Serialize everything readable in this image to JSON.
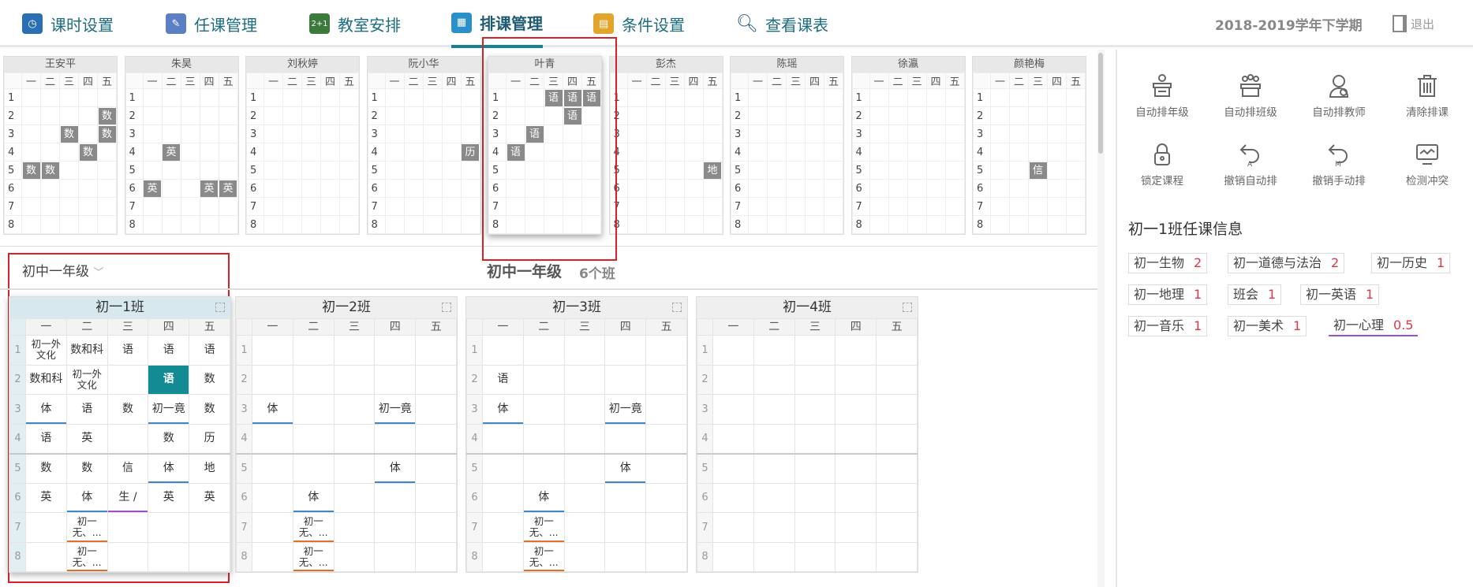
{
  "nav": {
    "items": [
      {
        "label": "课时设置",
        "icon": "clock-icon"
      },
      {
        "label": "任课管理",
        "icon": "pencil-icon"
      },
      {
        "label": "教室安排",
        "icon": "blackboard-icon"
      },
      {
        "label": "排课管理",
        "icon": "schedule-grid-icon"
      },
      {
        "label": "条件设置",
        "icon": "document-icon"
      },
      {
        "label": "查看课表",
        "icon": "search-icon"
      }
    ],
    "active": "排课管理",
    "term": "2018-2019学年下学期",
    "logout": "退出"
  },
  "weekdays": [
    "一",
    "二",
    "三",
    "四",
    "五"
  ],
  "periods": [
    "1",
    "2",
    "3",
    "4",
    "5",
    "6",
    "7",
    "8"
  ],
  "teachers": [
    {
      "name": "王安平",
      "cells": [
        [
          "",
          "",
          "",
          "",
          ""
        ],
        [
          "",
          "",
          "",
          "",
          "数"
        ],
        [
          "",
          "",
          "数",
          "",
          "数"
        ],
        [
          "",
          "",
          "",
          "数",
          ""
        ],
        [
          "数",
          "数",
          "",
          "",
          ""
        ],
        [
          "",
          "",
          "",
          "",
          ""
        ],
        [
          "",
          "",
          "",
          "",
          ""
        ],
        [
          "",
          "",
          "",
          "",
          ""
        ]
      ]
    },
    {
      "name": "朱昊",
      "cells": [
        [
          "",
          "",
          "",
          "",
          ""
        ],
        [
          "",
          "",
          "",
          "",
          ""
        ],
        [
          "",
          "",
          "",
          "",
          ""
        ],
        [
          "",
          "英",
          "",
          "",
          ""
        ],
        [
          "",
          "",
          "",
          "",
          ""
        ],
        [
          "英",
          "",
          "",
          "英",
          "英"
        ],
        [
          "",
          "",
          "",
          "",
          ""
        ],
        [
          "",
          "",
          "",
          "",
          ""
        ]
      ]
    },
    {
      "name": "刘秋婷",
      "cells": [
        [
          "",
          "",
          "",
          "",
          ""
        ],
        [
          "",
          "",
          "",
          "",
          ""
        ],
        [
          "",
          "",
          "",
          "",
          ""
        ],
        [
          "",
          "",
          "",
          "",
          ""
        ],
        [
          "",
          "",
          "",
          "",
          ""
        ],
        [
          "",
          "",
          "",
          "",
          ""
        ],
        [
          "",
          "",
          "",
          "",
          ""
        ],
        [
          "",
          "",
          "",
          "",
          ""
        ]
      ]
    },
    {
      "name": "阮小华",
      "cells": [
        [
          "",
          "",
          "",
          "",
          ""
        ],
        [
          "",
          "",
          "",
          "",
          ""
        ],
        [
          "",
          "",
          "",
          "",
          ""
        ],
        [
          "",
          "",
          "",
          "",
          "历"
        ],
        [
          "",
          "",
          "",
          "",
          ""
        ],
        [
          "",
          "",
          "",
          "",
          ""
        ],
        [
          "",
          "",
          "",
          "",
          ""
        ],
        [
          "",
          "",
          "",
          "",
          ""
        ]
      ]
    },
    {
      "name": "叶青",
      "cells": [
        [
          "",
          "",
          "语",
          "语",
          "语"
        ],
        [
          "",
          "",
          "",
          "语",
          ""
        ],
        [
          "",
          "语",
          "",
          "",
          ""
        ],
        [
          "语",
          "",
          "",
          "",
          ""
        ],
        [
          "",
          "",
          "",
          "",
          ""
        ],
        [
          "",
          "",
          "",
          "",
          ""
        ],
        [
          "",
          "",
          "",
          "",
          ""
        ],
        [
          "",
          "",
          "",
          "",
          ""
        ]
      ]
    },
    {
      "name": "彭杰",
      "cells": [
        [
          "",
          "",
          "",
          "",
          ""
        ],
        [
          "",
          "",
          "",
          "",
          ""
        ],
        [
          "",
          "",
          "",
          "",
          ""
        ],
        [
          "",
          "",
          "",
          "",
          ""
        ],
        [
          "",
          "",
          "",
          "",
          "地"
        ],
        [
          "",
          "",
          "",
          "",
          ""
        ],
        [
          "",
          "",
          "",
          "",
          ""
        ],
        [
          "",
          "",
          "",
          "",
          ""
        ]
      ]
    },
    {
      "name": "陈瑶",
      "cells": [
        [
          "",
          "",
          "",
          "",
          ""
        ],
        [
          "",
          "",
          "",
          "",
          ""
        ],
        [
          "",
          "",
          "",
          "",
          ""
        ],
        [
          "",
          "",
          "",
          "",
          ""
        ],
        [
          "",
          "",
          "",
          "",
          ""
        ],
        [
          "",
          "",
          "",
          "",
          ""
        ],
        [
          "",
          "",
          "",
          "",
          ""
        ],
        [
          "",
          "",
          "",
          "",
          ""
        ]
      ]
    },
    {
      "name": "徐瀛",
      "cells": [
        [
          "",
          "",
          "",
          "",
          ""
        ],
        [
          "",
          "",
          "",
          "",
          ""
        ],
        [
          "",
          "",
          "",
          "",
          ""
        ],
        [
          "",
          "",
          "",
          "",
          ""
        ],
        [
          "",
          "",
          "",
          "",
          ""
        ],
        [
          "",
          "",
          "",
          "",
          ""
        ],
        [
          "",
          "",
          "",
          "",
          ""
        ],
        [
          "",
          "",
          "",
          "",
          ""
        ]
      ]
    },
    {
      "name": "颜艳梅",
      "cells": [
        [
          "",
          "",
          "",
          "",
          ""
        ],
        [
          "",
          "",
          "",
          "",
          ""
        ],
        [
          "",
          "",
          "",
          "",
          ""
        ],
        [
          "",
          "",
          "",
          "",
          ""
        ],
        [
          "",
          "",
          "信",
          "",
          ""
        ],
        [
          "",
          "",
          "",
          "",
          ""
        ],
        [
          "",
          "",
          "",
          "",
          ""
        ],
        [
          "",
          "",
          "",
          "",
          ""
        ]
      ]
    }
  ],
  "grade": {
    "selector": "初中一年级",
    "title": "初中一年级",
    "count": "6个班"
  },
  "classes": [
    {
      "name": "初一1班",
      "cells": [
        [
          {
            "t": "初一外\n文化"
          },
          {
            "t": "数和科"
          },
          {
            "t": "语"
          },
          {
            "t": "语"
          },
          {
            "t": "语"
          }
        ],
        [
          {
            "t": "数和科"
          },
          {
            "t": "初一外\n文化"
          },
          {
            "t": ""
          },
          {
            "t": "语",
            "s": "hl"
          },
          {
            "t": "数"
          }
        ],
        [
          {
            "t": "体",
            "s": "ub"
          },
          {
            "t": "语"
          },
          {
            "t": "数"
          },
          {
            "t": "初一竟",
            "s": "ub"
          },
          {
            "t": "数"
          }
        ],
        [
          {
            "t": "语"
          },
          {
            "t": "英"
          },
          {
            "t": ""
          },
          {
            "t": "数"
          },
          {
            "t": "历"
          }
        ],
        [
          {
            "t": "数"
          },
          {
            "t": "数"
          },
          {
            "t": "信"
          },
          {
            "t": "体",
            "s": "ub"
          },
          {
            "t": "地"
          }
        ],
        [
          {
            "t": "英"
          },
          {
            "t": "体",
            "s": "ub"
          },
          {
            "t": "生 /",
            "s": "up"
          },
          {
            "t": "英"
          },
          {
            "t": "英"
          }
        ],
        [
          {
            "t": ""
          },
          {
            "t": "初一\n无、...",
            "s": "uo"
          },
          {
            "t": ""
          },
          {
            "t": ""
          },
          {
            "t": ""
          }
        ],
        [
          {
            "t": ""
          },
          {
            "t": "初一\n无、...",
            "s": "uo"
          },
          {
            "t": ""
          },
          {
            "t": ""
          },
          {
            "t": ""
          }
        ]
      ]
    },
    {
      "name": "初一2班",
      "cells": [
        [
          {
            "t": ""
          },
          {
            "t": ""
          },
          {
            "t": ""
          },
          {
            "t": ""
          },
          {
            "t": ""
          }
        ],
        [
          {
            "t": ""
          },
          {
            "t": ""
          },
          {
            "t": ""
          },
          {
            "t": ""
          },
          {
            "t": ""
          }
        ],
        [
          {
            "t": "体",
            "s": "ub"
          },
          {
            "t": ""
          },
          {
            "t": ""
          },
          {
            "t": "初一竟",
            "s": "ub"
          },
          {
            "t": ""
          }
        ],
        [
          {
            "t": ""
          },
          {
            "t": ""
          },
          {
            "t": ""
          },
          {
            "t": ""
          },
          {
            "t": ""
          }
        ],
        [
          {
            "t": ""
          },
          {
            "t": ""
          },
          {
            "t": ""
          },
          {
            "t": "体",
            "s": "ub"
          },
          {
            "t": ""
          }
        ],
        [
          {
            "t": ""
          },
          {
            "t": "体",
            "s": "ub"
          },
          {
            "t": ""
          },
          {
            "t": ""
          },
          {
            "t": ""
          }
        ],
        [
          {
            "t": ""
          },
          {
            "t": "初一\n无、...",
            "s": "uo"
          },
          {
            "t": ""
          },
          {
            "t": ""
          },
          {
            "t": ""
          }
        ],
        [
          {
            "t": ""
          },
          {
            "t": "初一\n无、...",
            "s": "uo"
          },
          {
            "t": ""
          },
          {
            "t": ""
          },
          {
            "t": ""
          }
        ]
      ]
    },
    {
      "name": "初一3班",
      "cells": [
        [
          {
            "t": ""
          },
          {
            "t": ""
          },
          {
            "t": ""
          },
          {
            "t": ""
          },
          {
            "t": ""
          }
        ],
        [
          {
            "t": "语"
          },
          {
            "t": ""
          },
          {
            "t": ""
          },
          {
            "t": ""
          },
          {
            "t": ""
          }
        ],
        [
          {
            "t": "体",
            "s": "ub"
          },
          {
            "t": ""
          },
          {
            "t": ""
          },
          {
            "t": "初一竟",
            "s": "ub"
          },
          {
            "t": ""
          }
        ],
        [
          {
            "t": ""
          },
          {
            "t": ""
          },
          {
            "t": ""
          },
          {
            "t": ""
          },
          {
            "t": ""
          }
        ],
        [
          {
            "t": ""
          },
          {
            "t": ""
          },
          {
            "t": ""
          },
          {
            "t": "体",
            "s": "ub"
          },
          {
            "t": ""
          }
        ],
        [
          {
            "t": ""
          },
          {
            "t": "体",
            "s": "ub"
          },
          {
            "t": ""
          },
          {
            "t": ""
          },
          {
            "t": ""
          }
        ],
        [
          {
            "t": ""
          },
          {
            "t": "初一\n无、...",
            "s": "uo"
          },
          {
            "t": ""
          },
          {
            "t": ""
          },
          {
            "t": ""
          }
        ],
        [
          {
            "t": ""
          },
          {
            "t": "初一\n无、...",
            "s": "uo"
          },
          {
            "t": ""
          },
          {
            "t": ""
          },
          {
            "t": ""
          }
        ]
      ]
    },
    {
      "name": "初一4班",
      "cells": [
        [
          {
            "t": ""
          },
          {
            "t": ""
          },
          {
            "t": ""
          },
          {
            "t": ""
          },
          {
            "t": ""
          }
        ],
        [
          {
            "t": ""
          },
          {
            "t": ""
          },
          {
            "t": ""
          },
          {
            "t": ""
          },
          {
            "t": ""
          }
        ],
        [
          {
            "t": ""
          },
          {
            "t": ""
          },
          {
            "t": ""
          },
          {
            "t": ""
          },
          {
            "t": ""
          }
        ],
        [
          {
            "t": ""
          },
          {
            "t": ""
          },
          {
            "t": ""
          },
          {
            "t": ""
          },
          {
            "t": ""
          }
        ],
        [
          {
            "t": ""
          },
          {
            "t": ""
          },
          {
            "t": ""
          },
          {
            "t": ""
          },
          {
            "t": ""
          }
        ],
        [
          {
            "t": ""
          },
          {
            "t": ""
          },
          {
            "t": ""
          },
          {
            "t": ""
          },
          {
            "t": ""
          }
        ],
        [
          {
            "t": ""
          },
          {
            "t": ""
          },
          {
            "t": ""
          },
          {
            "t": ""
          },
          {
            "t": ""
          }
        ],
        [
          {
            "t": ""
          },
          {
            "t": ""
          },
          {
            "t": ""
          },
          {
            "t": ""
          },
          {
            "t": ""
          }
        ]
      ]
    }
  ],
  "tools": [
    {
      "label": "自动排年级",
      "icon": "auto-grade-icon"
    },
    {
      "label": "自动排班级",
      "icon": "auto-class-icon"
    },
    {
      "label": "自动排教师",
      "icon": "auto-teacher-icon"
    },
    {
      "label": "清除排课",
      "icon": "trash-icon"
    },
    {
      "label": "锁定课程",
      "icon": "lock-icon"
    },
    {
      "label": "撤销自动排",
      "icon": "undo-auto-icon"
    },
    {
      "label": "撤销手动排",
      "icon": "undo-manual-icon"
    },
    {
      "label": "检测冲突",
      "icon": "conflict-monitor-icon"
    }
  ],
  "info": {
    "title": "初一1班任课信息",
    "tags": [
      {
        "name": "初一生物",
        "n": "2"
      },
      {
        "name": "初一道德与法治",
        "n": "2"
      },
      {
        "name": "初一历史",
        "n": "1"
      },
      {
        "name": "初一地理",
        "n": "1"
      },
      {
        "name": "班会",
        "n": "1"
      },
      {
        "name": "初一英语",
        "n": "1"
      },
      {
        "name": "初一音乐",
        "n": "1"
      },
      {
        "name": "初一美术",
        "n": "1"
      },
      {
        "name": "初一心理",
        "n": "0.5"
      }
    ]
  }
}
